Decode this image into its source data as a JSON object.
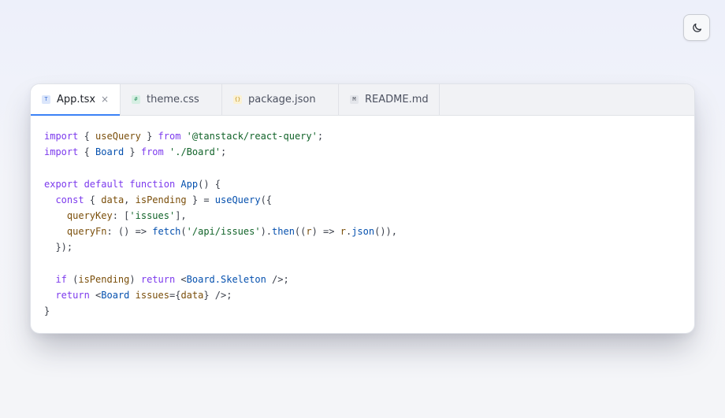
{
  "theme_toggle": {
    "icon": "moon-icon"
  },
  "tabs": [
    {
      "label": "App.tsx",
      "icon": "typescript-file-icon",
      "icon_glyph": "T",
      "icon_bg": "#dbe6fb",
      "icon_color": "#3b6fd6",
      "active": true,
      "close": "×"
    },
    {
      "label": "theme.css",
      "icon": "css-file-icon",
      "icon_glyph": "#",
      "icon_bg": "#d6efe3",
      "icon_color": "#3a9a6c",
      "active": false
    },
    {
      "label": "package.json",
      "icon": "json-file-icon",
      "icon_glyph": "{}",
      "icon_bg": "#fbf1d2",
      "icon_color": "#b8860b",
      "active": false
    },
    {
      "label": "README.md",
      "icon": "markdown-file-icon",
      "icon_glyph": "M",
      "icon_bg": "#e3e5ea",
      "icon_color": "#4a4f5a",
      "active": false
    }
  ],
  "colors": {
    "accent": "#3b82f6",
    "keyword": "#7c3aed",
    "string": "#116329",
    "function": "#0550ae",
    "variable": "#7a4e0a"
  },
  "code": {
    "l1": {
      "kw": "import",
      "a": " { ",
      "id": "useQuery",
      "b": " } ",
      "kw2": "from",
      "c": " ",
      "str": "'@tanstack/react-query'",
      "d": ";"
    },
    "l2": {
      "kw": "import",
      "a": " { ",
      "id": "Board",
      "b": " } ",
      "kw2": "from",
      "c": " ",
      "str": "'./Board'",
      "d": ";"
    },
    "l4": {
      "kw": "export default function",
      "a": " ",
      "fn": "App",
      "b": "() {"
    },
    "l5": {
      "ind": "  ",
      "kw": "const",
      "a": " { ",
      "v1": "data",
      "b": ", ",
      "v2": "isPending",
      "c": " } = ",
      "fn": "useQuery",
      "d": "({"
    },
    "l6": {
      "ind": "    ",
      "prop": "queryKey",
      "a": ": [",
      "str": "'issues'",
      "b": "],"
    },
    "l7": {
      "ind": "    ",
      "prop": "queryFn",
      "a": ": () => ",
      "fn": "fetch",
      "b": "(",
      "str": "'/api/issues'",
      "c": ").",
      "fn2": "then",
      "d": "((",
      "v1": "r",
      "e": ") => ",
      "v2": "r",
      "f": ".",
      "fn3": "json",
      "g": "()),"
    },
    "l8": {
      "ind": "  ",
      "a": "});"
    },
    "l10": {
      "ind": "  ",
      "kw": "if",
      "a": " (",
      "v": "isPending",
      "b": ") ",
      "kw2": "return",
      "c": " <",
      "tag": "Board.Skeleton",
      "d": " />;"
    },
    "l11": {
      "ind": "  ",
      "kw": "return",
      "a": " <",
      "tag": "Board",
      "b": " ",
      "attr": "issues",
      "c": "={",
      "v": "data",
      "d": "} />;"
    },
    "l12": {
      "a": "}"
    }
  }
}
